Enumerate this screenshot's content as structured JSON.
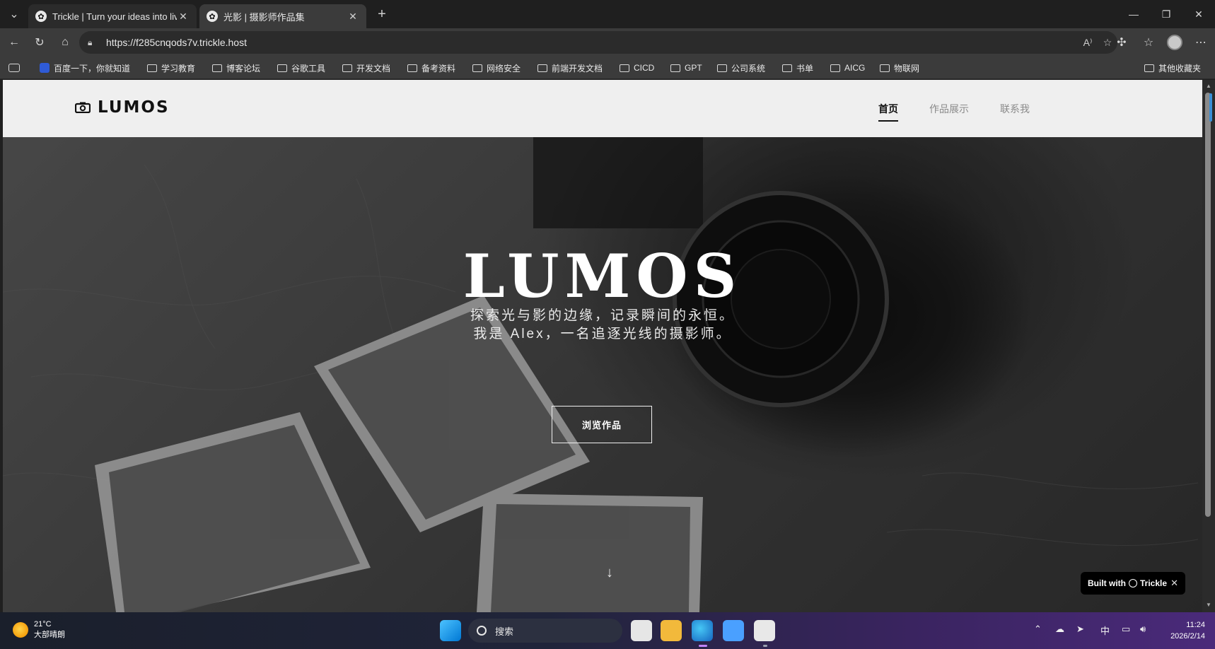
{
  "browser": {
    "tabs": [
      {
        "title": "Trickle | Turn your ideas into live a",
        "active": false
      },
      {
        "title": "光影 | 摄影师作品集",
        "active": true
      }
    ],
    "new_tab": "+",
    "window_controls": {
      "minimize": "—",
      "restore": "❐",
      "close": "✕"
    },
    "url": "https://f285cnqods7v.trickle.host",
    "bookmarks": [
      {
        "label": "百度一下，你就知道",
        "icon": "baidu-icon"
      },
      {
        "label": "学习教育",
        "icon": "folder-icon"
      },
      {
        "label": "博客论坛",
        "icon": "folder-icon"
      },
      {
        "label": "谷歌工具",
        "icon": "folder-icon"
      },
      {
        "label": "开发文档",
        "icon": "folder-icon"
      },
      {
        "label": "备考资料",
        "icon": "folder-icon"
      },
      {
        "label": "网络安全",
        "icon": "folder-icon"
      },
      {
        "label": "前端开发文档",
        "icon": "folder-icon"
      },
      {
        "label": "CICD",
        "icon": "folder-icon"
      },
      {
        "label": "GPT",
        "icon": "folder-icon"
      },
      {
        "label": "公司系统",
        "icon": "folder-icon"
      },
      {
        "label": "书单",
        "icon": "folder-icon"
      },
      {
        "label": "AICG",
        "icon": "folder-icon"
      },
      {
        "label": "物联网",
        "icon": "folder-icon"
      }
    ],
    "other_bookmarks": "其他收藏夹"
  },
  "site": {
    "brand": "LUMOS",
    "nav": [
      {
        "label": "首页",
        "active": true
      },
      {
        "label": "作品展示",
        "active": false
      },
      {
        "label": "联系我",
        "active": false
      }
    ],
    "hero": {
      "title": "LUMOS",
      "line1": "探索光与影的边缘，记录瞬间的永恒。",
      "line2": "我是 Alex，一名追逐光线的摄影师。",
      "button": "浏览作品",
      "scroll_hint_icon": "arrow-down-icon"
    },
    "badge": {
      "prefix": "Built with",
      "name": "Trickle",
      "close": "✕"
    }
  },
  "taskbar": {
    "weather": {
      "temp": "21°C",
      "desc": "大部晴朗"
    },
    "search_placeholder": "搜索",
    "tray": {
      "ime": "中"
    },
    "clock": {
      "time": "11:24",
      "date": "2026/2/14"
    }
  },
  "colors": {
    "nav_bg": "#efefef",
    "browser_dark": "#1f1f1f",
    "toolbar": "#3b3b3b",
    "accent_blue": "#3b8fd6"
  }
}
